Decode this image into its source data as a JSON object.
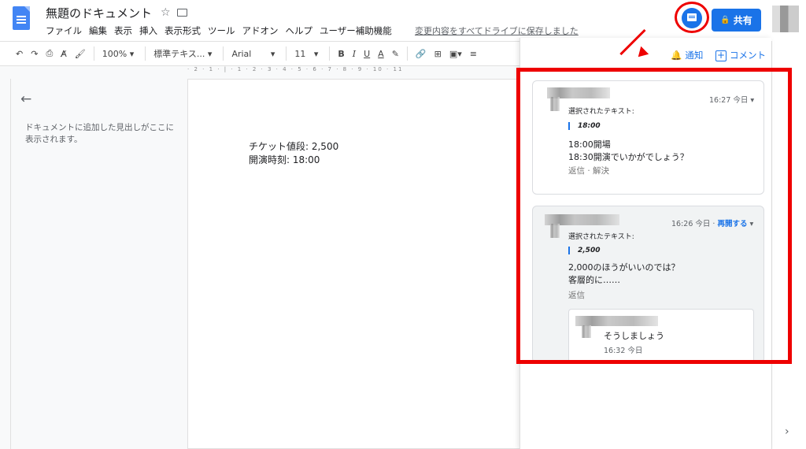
{
  "titlebar": {
    "doc_title": "無題のドキュメント",
    "save_status": "変更内容をすべてドライブに保存しました",
    "share_label": "共有",
    "menu": [
      "ファイル",
      "編集",
      "表示",
      "挿入",
      "表示形式",
      "ツール",
      "アドオン",
      "ヘルプ",
      "ユーザー補助機能"
    ]
  },
  "toolbar": {
    "zoom": "100%",
    "style": "標準テキス...",
    "font": "Arial",
    "size": "11",
    "bold": "B",
    "italic": "I",
    "underline": "U",
    "text_color": "A"
  },
  "ruler": "· 2 · 1 · | · 1 · 2 · 3 · 4 · 5 · 6 · 7 · 8 · 9 · 10 · 11",
  "outline": {
    "hint": "ドキュメントに追加した見出しがここに表示されます。"
  },
  "document": {
    "lines": [
      "チケット値段: 2,500",
      "開演時刻: 18:00"
    ]
  },
  "comments_panel": {
    "notifications_label": "通知",
    "add_comment_label": "コメント",
    "comments": [
      {
        "time": "16:27 今日",
        "selected_label": "選択されたテキスト:",
        "quote": "18:00",
        "body": [
          "18:00開場",
          "18:30開演でいかがでしょう？"
        ],
        "actions": "返信 · 解決"
      },
      {
        "time": "16:26 今日 ·",
        "reopen": "再開する",
        "selected_label": "選択されたテキスト:",
        "quote": "2,500",
        "body": [
          "2,000のほうがいいのでは？",
          "客層的に……"
        ],
        "actions": "返信",
        "reply": {
          "body": "そうしましょう",
          "time": "16:32 今日"
        }
      }
    ]
  },
  "colors": {
    "accent": "#1a73e8",
    "highlight": "#ee0000"
  }
}
